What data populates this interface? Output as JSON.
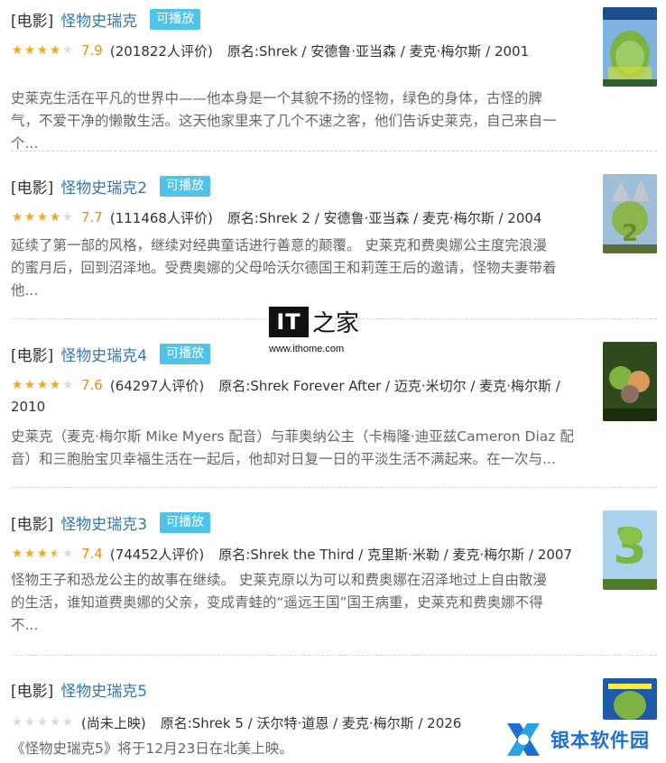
{
  "items": [
    {
      "category": "[电影]",
      "title": "怪物史瑞克",
      "play_label": "可播放",
      "stars": 4,
      "score": "7.9",
      "votes": "(201822人评价)",
      "original": "原名:Shrek / 安德鲁·亚当森 / 麦克·梅尔斯 / 2001",
      "desc": [
        "史莱克生活在平凡的世界中——他本身是一个其貌不扬的怪物，绿色的身体，古怪的脾",
        "气，不爱干净的懒散生活。这天他家里来了几个不速之客，他们告诉史莱克，自己来自一",
        "个..."
      ],
      "poster": "poster-shrek"
    },
    {
      "category": "[电影]",
      "title": "怪物史瑞克2",
      "play_label": "可播放",
      "stars": 4,
      "score": "7.7",
      "votes": "(111468人评价)",
      "original": "原名:Shrek 2 / 安德鲁·亚当森 / 麦克·梅尔斯 / 2004",
      "desc": [
        "延续了第一部的风格，继续对经典童话进行善意的颠覆。 史莱克和费奥娜公主度完浪漫",
        "的蜜月后，回到沼泽地。受费奥娜的父母哈沃尔德国王和莉莲王后的邀请，怪物夫妻带着",
        "他..."
      ],
      "poster": "poster-shrek-2"
    },
    {
      "category": "[电影]",
      "title": "怪物史瑞克4",
      "play_label": "可播放",
      "stars": 4,
      "score": "7.6",
      "votes": "(64297人评价)",
      "original": "原名:Shrek Forever After / 迈克·米切尔 / 麦克·梅尔斯 /",
      "original2": "2010",
      "desc": [
        "史莱克（麦克·梅尔斯 Mike Myers 配音）与菲奥纳公主（卡梅隆·迪亚兹Cameron Diaz 配",
        "音）和三胞胎宝贝幸福生活在一起后，他却对日复一日的平淡生活不满起来。在一次与..."
      ],
      "poster": "poster-shrek-4"
    },
    {
      "category": "[电影]",
      "title": "怪物史瑞克3",
      "play_label": "可播放",
      "stars": 3.5,
      "score": "7.4",
      "votes": "(74452人评价)",
      "original": "原名:Shrek the Third / 克里斯·米勒 / 麦克·梅尔斯 / 2007",
      "desc": [
        "怪物王子和恐龙公主的故事在继续。 史莱克原以为可以和费奥娜在沼泽地过上自由散漫",
        "的生活，谁知道费奥娜的父亲，变成青蛙的“遥远王国”国王病重，史莱克和费奥娜不得",
        "不..."
      ],
      "poster": "poster-shrek-3"
    },
    {
      "category": "[电影]",
      "title": "怪物史瑞克5",
      "stars": 0,
      "votes": "(尚未上映)",
      "original": "原名:Shrek 5 / 沃尔特·道恩 / 麦克·梅尔斯 / 2026",
      "desc": [
        "《怪物史瑞克5》将于12月23日在北美上映。"
      ],
      "poster": "poster-shrek-5"
    }
  ],
  "watermark": {
    "logo_text": "IT",
    "logo_cn": "之家",
    "url": "www.ithome.com"
  },
  "brand": {
    "text": "银本软件园",
    "color": "#1d6fd1"
  },
  "colors": {
    "title": "#3377aa",
    "play_badge": "#4fc3e8",
    "star_on": "#f5a623",
    "score": "#e09015"
  }
}
